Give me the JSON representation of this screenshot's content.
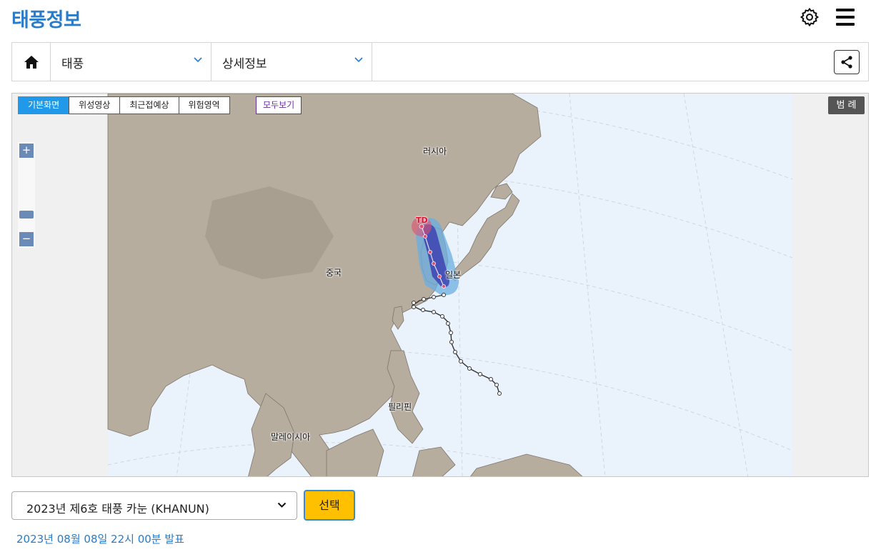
{
  "header": {
    "title": "태풍정보",
    "settings_icon": "gear-icon",
    "menu_icon": "hamburger-menu-icon"
  },
  "nav": {
    "home_icon": "home-icon",
    "category": "태풍",
    "subcategory": "상세정보",
    "share_icon": "share-icon"
  },
  "map": {
    "tabs": [
      {
        "label": "기본화면",
        "active": true
      },
      {
        "label": "위성영상",
        "active": false
      },
      {
        "label": "최근접예상",
        "active": false
      },
      {
        "label": "위험영역",
        "active": false
      }
    ],
    "show_all": "모두보기",
    "legend": "범 례",
    "zoom_in": "+",
    "zoom_out": "−",
    "labels": {
      "russia": "러시아",
      "china": "중국",
      "japan": "일본",
      "philippines": "필리핀",
      "malaysia": "말레이시아",
      "storm_status": "TD"
    },
    "colors": {
      "ocean": "#eaf2fc",
      "land": "#b7ad9f",
      "danger_zone": "#6aaee0",
      "strong_wind_zone": "#3a3bb0",
      "track": "#333333",
      "td_marker": "#e0102a"
    }
  },
  "typhoon": {
    "selected": "2023년 제6호 태풍 카눈 (KHANUN)",
    "select_button": "선택",
    "announcement": "2023년 08월 08일 22시 00분 발표"
  }
}
